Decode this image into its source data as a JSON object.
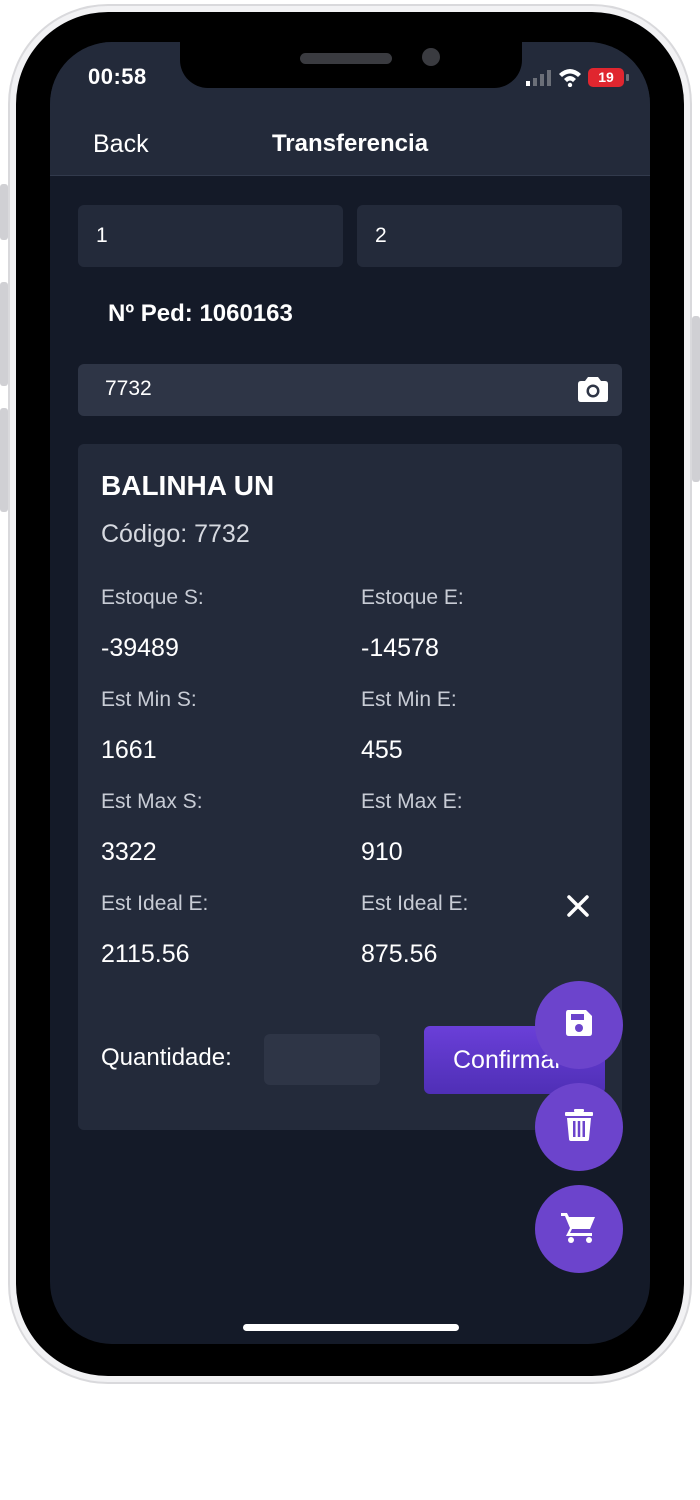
{
  "status_bar": {
    "time": "00:58",
    "battery": "19"
  },
  "nav": {
    "back_label": "Back",
    "title": "Transferencia"
  },
  "fields": {
    "origin": "1",
    "destination": "2"
  },
  "order": {
    "label": "Nº Ped: 1060163"
  },
  "scan": {
    "value": "7732",
    "icon": "camera-icon"
  },
  "product": {
    "name": "BALINHA UN",
    "code": "Código: 7732",
    "stats": [
      {
        "left_label": "Estoque S:",
        "left_value": "-39489",
        "right_label": "Estoque E:",
        "right_value": "-14578"
      },
      {
        "left_label": "Est Min S:",
        "left_value": "1661",
        "right_label": "Est Min E:",
        "right_value": "455"
      },
      {
        "left_label": "Est Max S:",
        "left_value": "3322",
        "right_label": "Est Max E:",
        "right_value": "910"
      },
      {
        "left_label": "Est Ideal E:",
        "left_value": "2115.56",
        "right_label": "Est Ideal E:",
        "right_value": "875.56"
      }
    ],
    "quantity_label": "Quantidade:",
    "quantity_value": "",
    "confirm_label": "Confirmar"
  },
  "fabs": [
    {
      "icon": "save-icon"
    },
    {
      "icon": "trash-icon"
    },
    {
      "icon": "cart-icon"
    }
  ],
  "colors": {
    "background": "#141a28",
    "surface": "#232a3a",
    "accent": "#6c44cc",
    "battery": "#e0262f"
  }
}
